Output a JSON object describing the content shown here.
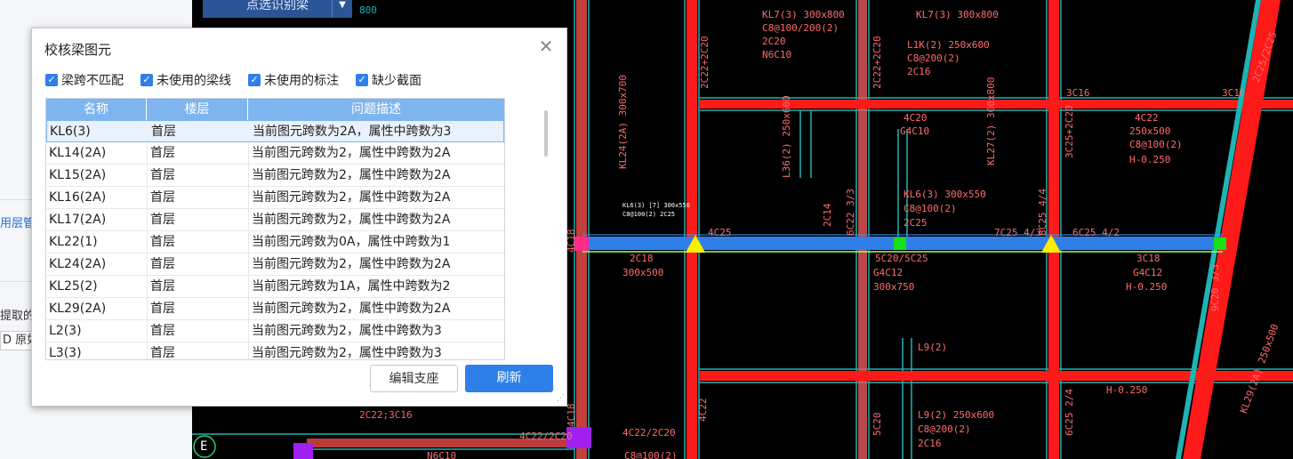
{
  "left_panel": {
    "fragment1": "用层管",
    "fragment2": "提取的",
    "fragment3": "D 原如"
  },
  "top_button": {
    "label": "点选识别梁",
    "caret": "▼"
  },
  "dialog": {
    "title": "校核梁图元",
    "close": "✕",
    "checkboxes": [
      {
        "label": "梁跨不匹配",
        "checked": true
      },
      {
        "label": "未使用的梁线",
        "checked": true
      },
      {
        "label": "未使用的标注",
        "checked": true
      },
      {
        "label": "缺少截面",
        "checked": true
      }
    ],
    "check_mark": "✓",
    "columns": [
      "名称",
      "楼层",
      "问题描述"
    ],
    "rows": [
      {
        "name": "KL6(3)",
        "floor": "首层",
        "desc": "当前图元跨数为2A，属性中跨数为3"
      },
      {
        "name": "KL14(2A)",
        "floor": "首层",
        "desc": "当前图元跨数为2，属性中跨数为2A"
      },
      {
        "name": "KL15(2A)",
        "floor": "首层",
        "desc": "当前图元跨数为2，属性中跨数为2A"
      },
      {
        "name": "KL16(2A)",
        "floor": "首层",
        "desc": "当前图元跨数为2，属性中跨数为2A"
      },
      {
        "name": "KL17(2A)",
        "floor": "首层",
        "desc": "当前图元跨数为2，属性中跨数为2A"
      },
      {
        "name": "KL22(1)",
        "floor": "首层",
        "desc": "当前图元跨数为0A，属性中跨数为1"
      },
      {
        "name": "KL24(2A)",
        "floor": "首层",
        "desc": "当前图元跨数为2，属性中跨数为2A"
      },
      {
        "name": "KL25(2)",
        "floor": "首层",
        "desc": "当前图元跨数为1A，属性中跨数为2"
      },
      {
        "name": "KL29(2A)",
        "floor": "首层",
        "desc": "当前图元跨数为2，属性中跨数为2A"
      },
      {
        "name": "L2(3)",
        "floor": "首层",
        "desc": "当前图元跨数为2，属性中跨数为3"
      },
      {
        "name": "L3(3)",
        "floor": "首层",
        "desc": "当前图元跨数为2，属性中跨数为3"
      }
    ],
    "edit_button": "编辑支座",
    "refresh_button": "刷新"
  },
  "cad_labels": {
    "kl7": "KL7(3) 300x800",
    "kl7_stirrup": "C8@100/200(2)",
    "kl7_top": "2C20",
    "kl7_side": "N6C10",
    "l1k": "L1K(2) 250x600",
    "l1k_stirrup": "C8@200(2)",
    "l1k_bottom": "2C16",
    "t800": "800",
    "r3c16a": "3C16",
    "r3c16b": "3C16",
    "g4c10": "G4C10",
    "t4c20": "4C20",
    "t4c22": "4C22",
    "t250x500": "250x500",
    "tc8": "C8@100(2)",
    "th0250": "H-0.250",
    "kl6_3": "KL6(3) 300x550",
    "kl6_st": "C8@100(2)",
    "kl6_2c25": "2C25",
    "t4c25": "4C25",
    "t7c25": "7C25 4/3",
    "t6c25": "6C25 4/2",
    "t2c18": "2C18",
    "t300x500": "300x500",
    "t5c20": "5C20/5C25",
    "tg4c12": "G4C12",
    "t300x750": "300x750",
    "r3c18": "3C18",
    "rg4c12": "G4C12",
    "rh0250": "H-0.250",
    "l9a": "L9(2)",
    "l9b": "L9(2) 250x600",
    "l9_st": "C8@200(2)",
    "l9_2c16": "2C16",
    "h0250b": "H-0.250",
    "t2c22": "2C22;3C16",
    "t4c22b": "4C22/2C20",
    "t4c22c": "4C22/2C20",
    "n6c10": "N6C10",
    "c8b": "C8@100(2)",
    "e_axis": "E",
    "v_2c22": "2C22+2C20",
    "v_kl24": "KL24(2A) 300x700",
    "v_2c22b": "2C22+2C20",
    "v_l36": "L36(2) 250x600",
    "v_kl27": "KL27(2) 300x800",
    "v_3c25": "3C25+2C20",
    "v_2c14": "2C14",
    "v_6c22": "6C22 3/3",
    "v_8c25": "8C25 4/4",
    "v_9c20": "9C20 3/3",
    "v_2c25": "2C25/2C25",
    "v_4c22": "4C22",
    "v_5c20": "5C20",
    "v_6c25": "6C25 2/4",
    "v_4c18": "4C18",
    "v_4c18b": "4C18",
    "v_kl29": "KL29(2A) 250x500",
    "small1": "KL6(3) [7] 300x550",
    "small2": "C8@100(2) 2C25"
  }
}
